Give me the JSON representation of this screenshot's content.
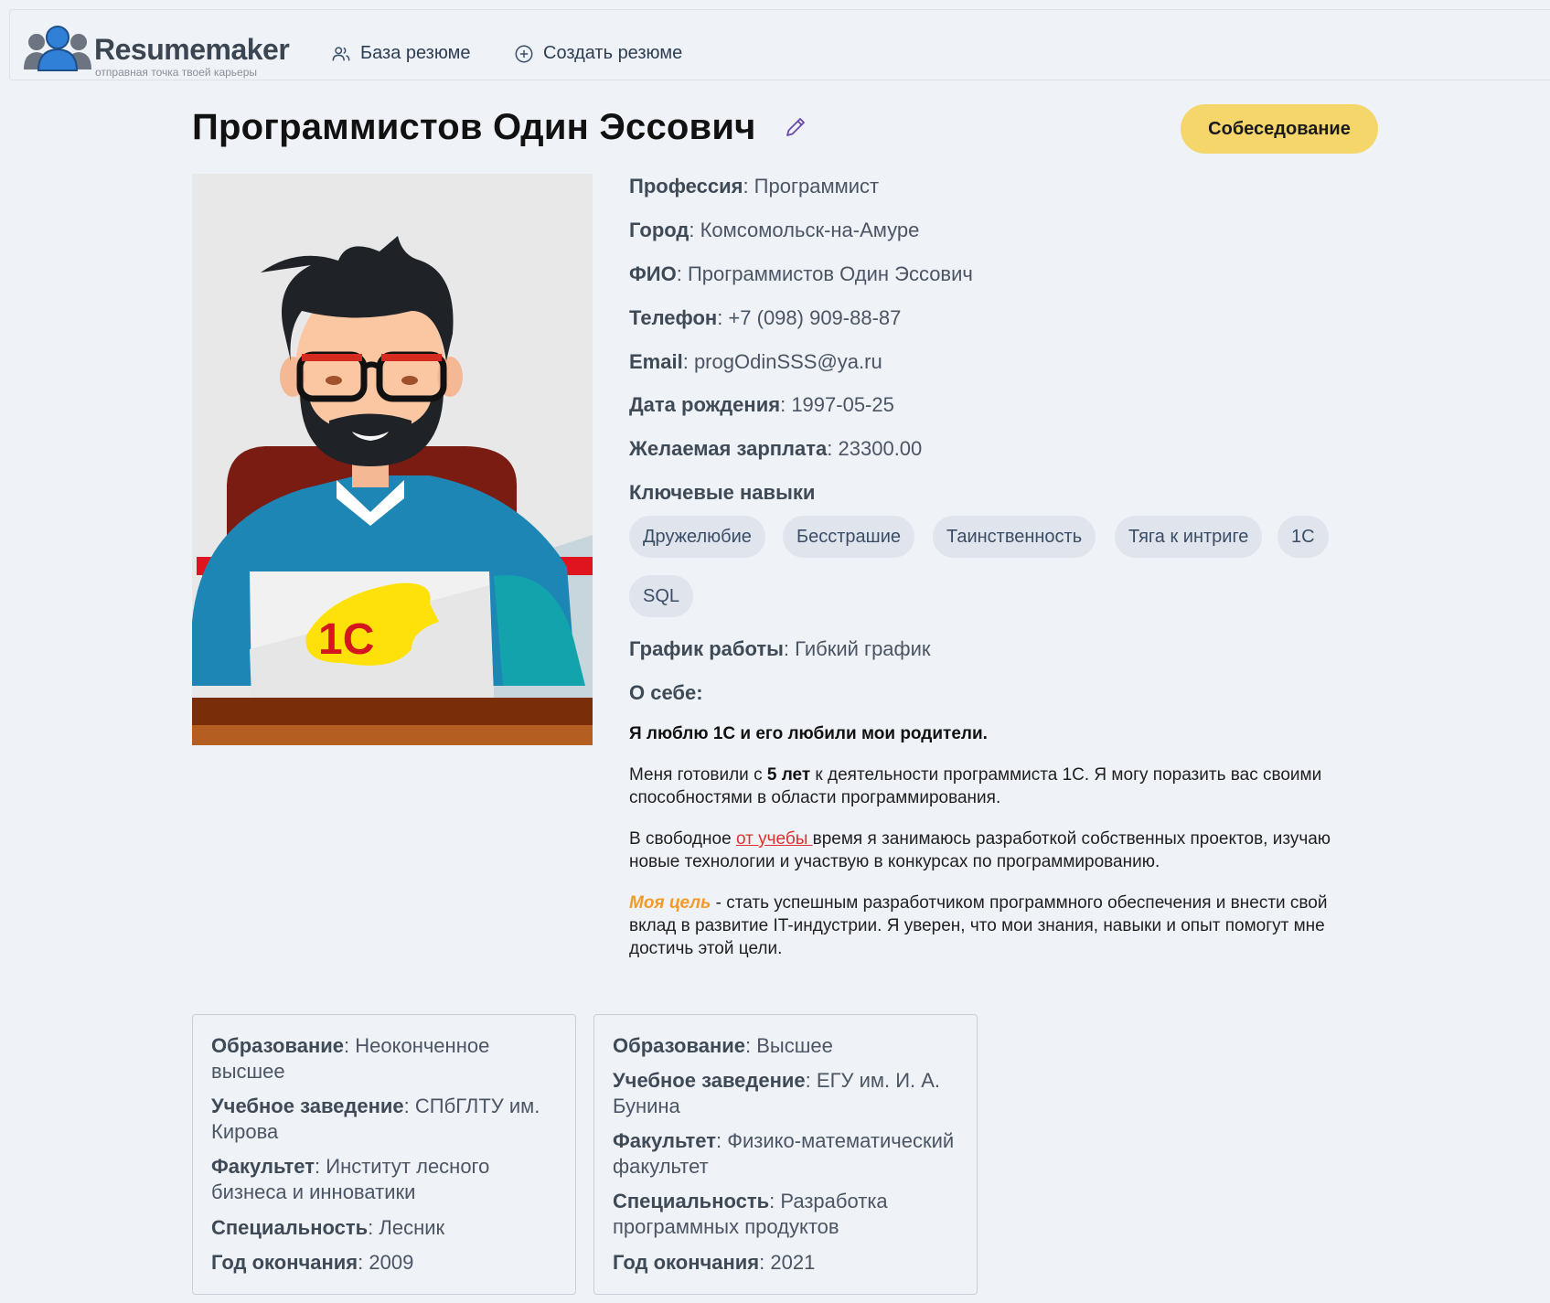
{
  "brand": {
    "name": "Resumemaker",
    "tagline": "отправная точка твоей карьеры"
  },
  "nav": {
    "resume_db": "База резюме",
    "create_resume": "Создать резюме"
  },
  "candidate": {
    "full_name": "Программистов Один Эссович",
    "status_button": "Собеседование"
  },
  "fields": {
    "profession_label": "Профессия",
    "profession": "Программист",
    "city_label": "Город",
    "city": "Комсомольск-на-Амуре",
    "fio_label": "ФИО",
    "fio": "Программистов Один Эссович",
    "phone_label": "Телефон",
    "phone": "+7 (098) 909-88-87",
    "email_label": "Email",
    "email": "progOdinSSS@ya.ru",
    "birth_label": "Дата рождения",
    "birth": "1997-05-25",
    "salary_label": "Желаемая зарплата",
    "salary": "23300.00",
    "skills_label": "Ключевые навыки",
    "schedule_label": "График работы",
    "schedule": "Гибкий график",
    "about_label": "О себе"
  },
  "skills": [
    "Дружелюбие",
    "Бесстрашие",
    "Таинственность",
    "Тяга к интриге",
    "1С",
    "SQL"
  ],
  "about": {
    "p1": "Я люблю 1С и его любили мои родители.",
    "p2_a": "Меня готовили с ",
    "p2_b": "5 лет",
    "p2_c": " к деятельности программиста 1С. Я могу поразить вас своими способностями в области программирования.",
    "p3_a": "В свободное ",
    "p3_link": "от учебы ",
    "p3_c": "время я занимаюсь разработкой собственных проектов, изучаю новые технологии и участвую в конкурсах по программированию.",
    "p4_goal": "Моя цель",
    "p4_c": " - стать успешным разработчиком программного обеспечения и внести свой вклад в развитие IT-индустрии. Я уверен, что мои знания, навыки и опыт помогут мне достичь этой цели."
  },
  "education": [
    {
      "edu_label": "Образование",
      "edu": "Неоконченное высшее",
      "inst_label": "Учебное заведение",
      "inst": "СПбГЛТУ им. Кирова",
      "fac_label": "Факультет",
      "fac": "Институт лесного бизнеса и инноватики",
      "spec_label": "Специальность",
      "spec": "Лесник",
      "year_label": "Год окончания",
      "year": "2009"
    },
    {
      "edu_label": "Образование",
      "edu": "Высшее",
      "inst_label": "Учебное заведение",
      "inst": "ЕГУ им. И. А. Бунина",
      "fac_label": "Факультет",
      "fac": "Физико-математический факультет",
      "spec_label": "Специальность",
      "spec": "Разработка программных продуктов",
      "year_label": "Год окончания",
      "year": "2021"
    }
  ],
  "colors": {
    "status_button": "#f4d66a",
    "link_red": "#e03030",
    "goal_orange": "#f29a28",
    "chip_bg": "#e0e5ed",
    "page_bg": "#eff2f7"
  },
  "icons": {
    "logo": "people-group-icon",
    "resume_db": "users-icon",
    "create": "plus-circle-icon",
    "edit": "pencil-icon"
  },
  "photo_logo_text": "1С"
}
